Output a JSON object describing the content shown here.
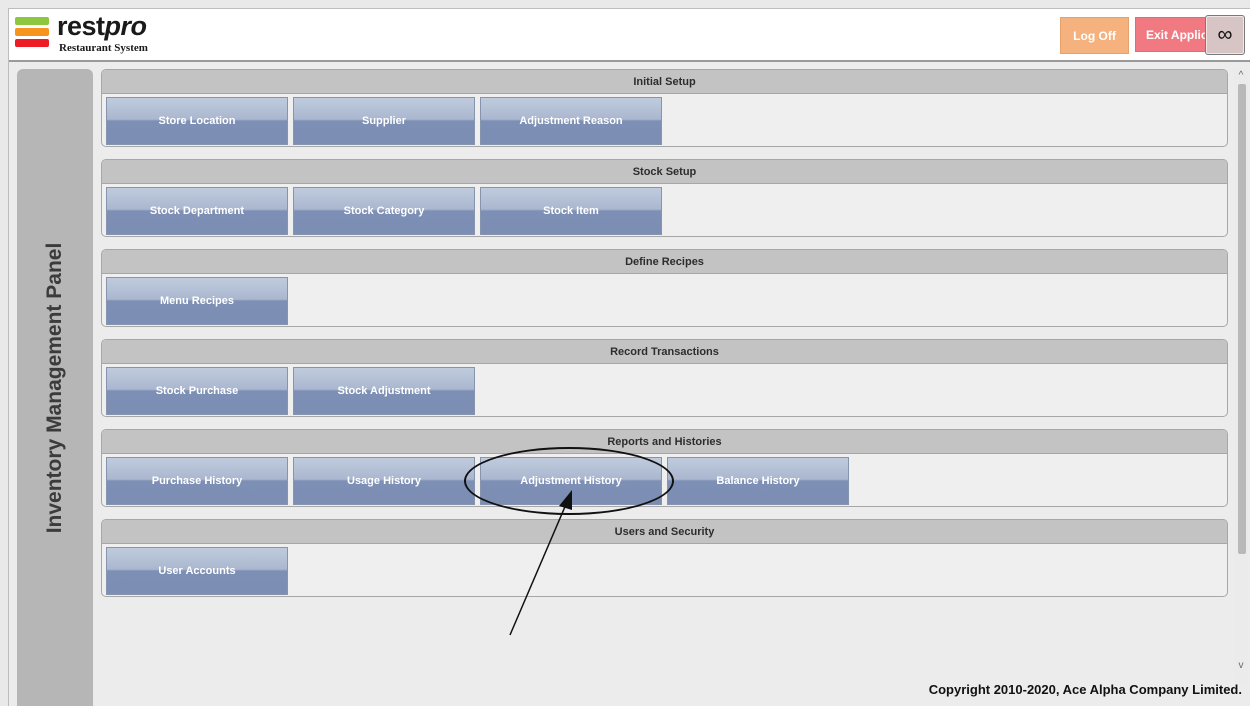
{
  "header": {
    "brand_main": "rest",
    "brand_accent": "pro",
    "brand_sub": "Restaurant System",
    "logoff_label": "Log Off",
    "exit_label": "Exit Applica",
    "settings_icon": "infinity-icon",
    "logo_colors": [
      "#8dc63f",
      "#f7941d",
      "#ed1c24"
    ]
  },
  "sidebar": {
    "title": "Inventory Management Panel"
  },
  "sections": [
    {
      "title": "Initial Setup",
      "buttons": [
        "Store Location",
        "Supplier",
        "Adjustment Reason"
      ]
    },
    {
      "title": "Stock Setup",
      "buttons": [
        "Stock Department",
        "Stock Category",
        "Stock Item"
      ]
    },
    {
      "title": "Define Recipes",
      "buttons": [
        "Menu Recipes"
      ]
    },
    {
      "title": "Record Transactions",
      "buttons": [
        "Stock Purchase",
        "Stock Adjustment"
      ]
    },
    {
      "title": "Reports and Histories",
      "buttons": [
        "Purchase History",
        "Usage History",
        "Adjustment History",
        "Balance History"
      ]
    },
    {
      "title": "Users and Security",
      "buttons": [
        "User Accounts"
      ]
    }
  ],
  "footer": {
    "copyright": "Copyright 2010-2020, Ace Alpha Company Limited."
  },
  "colors": {
    "button_gradient_top": "#c0cbdd",
    "button_gradient_bottom": "#7c8eb3",
    "logoff_bg": "#f5b27e",
    "exit_bg": "#f17a82",
    "section_header_bg": "#c3c3c3",
    "sidebar_bg": "#b6b6b6"
  }
}
